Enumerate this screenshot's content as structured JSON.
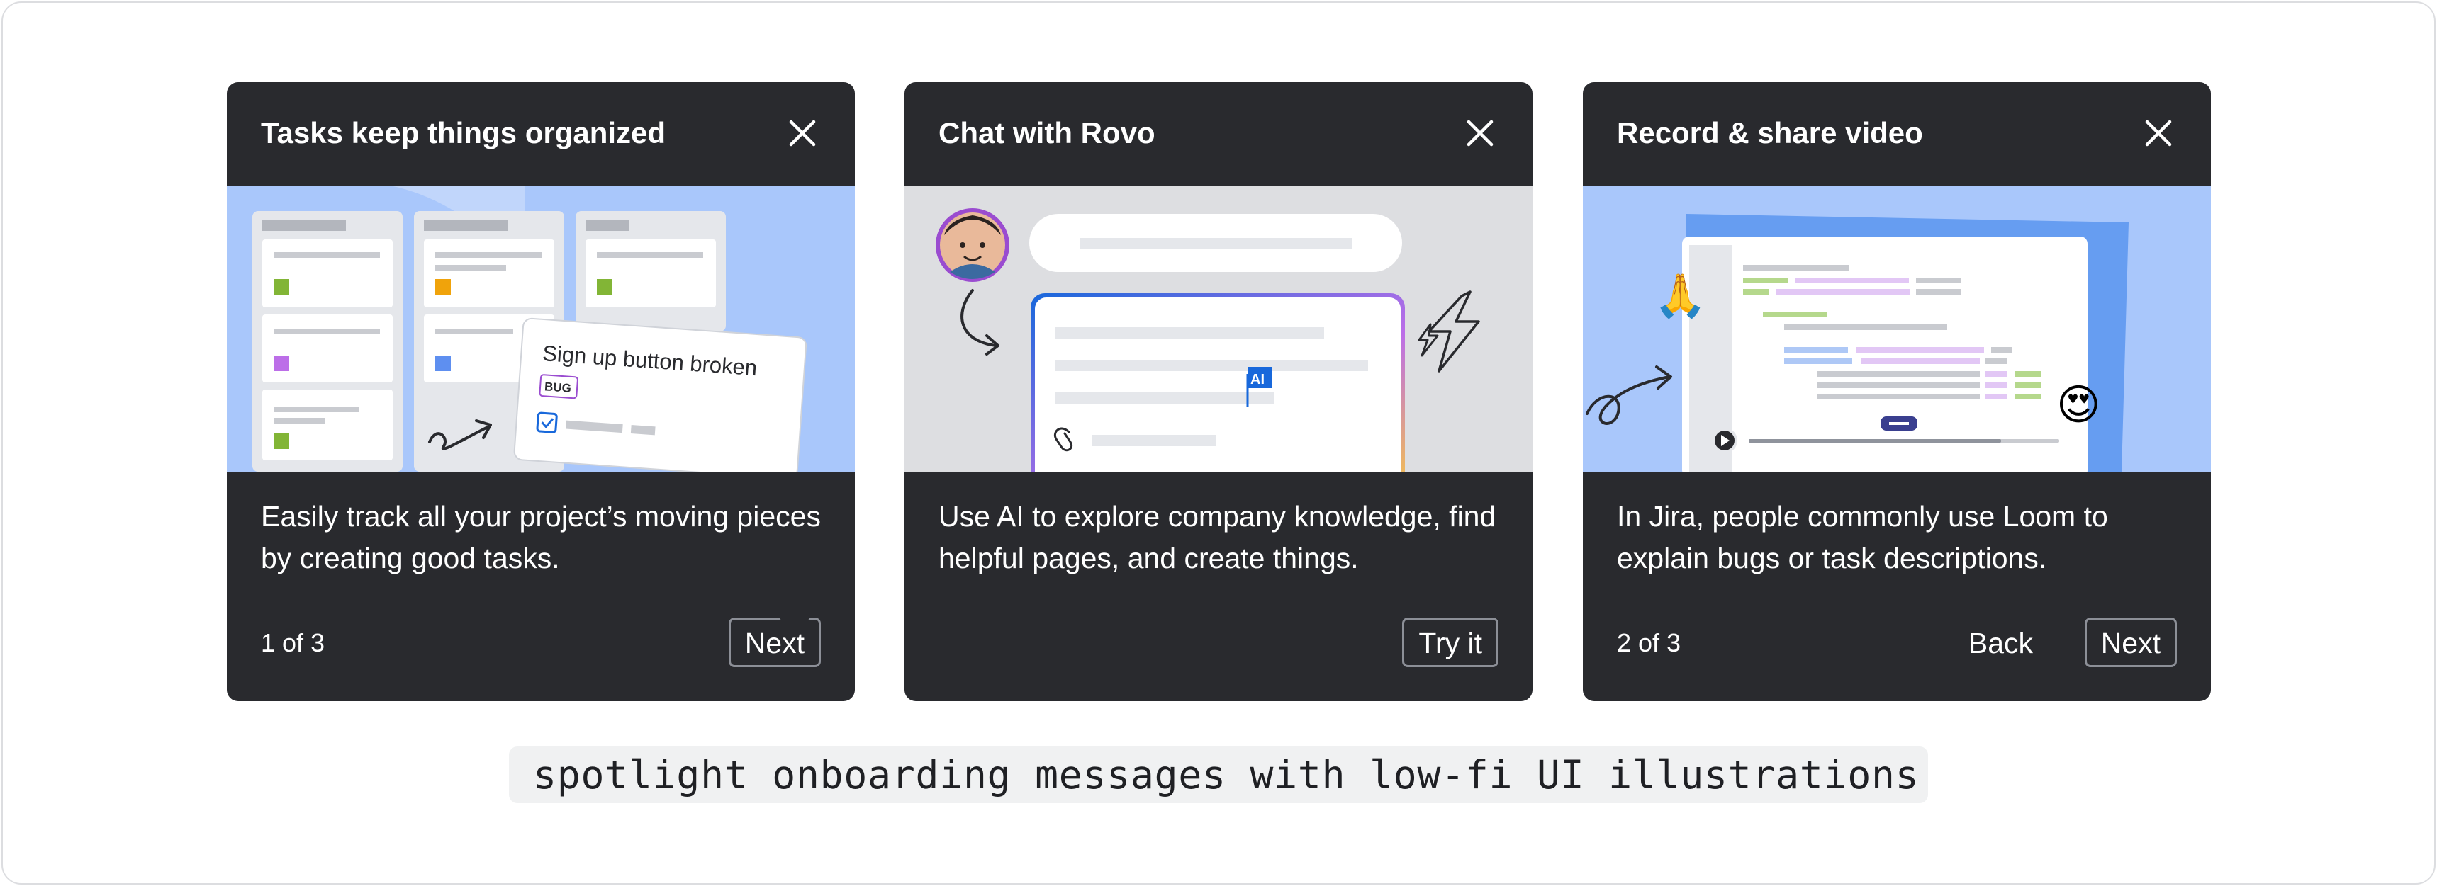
{
  "cards": [
    {
      "title": "Tasks keep things organized",
      "illustration": {
        "card_title": "Sign up button broken",
        "badge": "BUG"
      },
      "body": "Easily track all your project’s moving pieces by creating good tasks.",
      "counter": "1 of 3",
      "primary_label": "Next",
      "close_icon": "close-icon"
    },
    {
      "title": "Chat with Rovo",
      "illustration": {
        "ai_tag": "AI"
      },
      "body": "Use AI to explore company knowledge, find helpful pages, and create things.",
      "primary_label": "Try it",
      "close_icon": "close-icon"
    },
    {
      "title": "Record & share video",
      "illustration": {
        "emoji_pray": "🙏",
        "emoji_love": "😍"
      },
      "body": "In Jira, people commonly use Loom to explain bugs or task descriptions.",
      "counter": "2 of 3",
      "secondary_label": "Back",
      "primary_label": "Next",
      "close_icon": "close-icon"
    }
  ],
  "caption": "spotlight onboarding messages with low-fi UI illustrations",
  "colors": {
    "card_bg": "#292a2e",
    "tasks_illustration_bg": "#a9c7fb",
    "rovo_illustration_bg": "#dddee1",
    "video_illustration_bg": "#a9c7fb",
    "accent_blue": "#1868db",
    "bug_purple": "#9a4cd0",
    "green": "#82b536",
    "orange": "#f0a30b"
  }
}
